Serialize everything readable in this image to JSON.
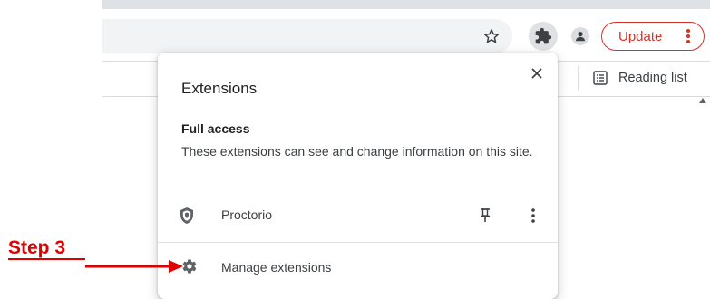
{
  "toolbar": {
    "bookmark_star": "star-icon",
    "extensions_icon": "puzzle-piece-icon",
    "profile_icon": "person-icon",
    "update_label": "Update",
    "update_color": "#d93025"
  },
  "bookmarks_bar": {
    "reading_list_label": "Reading list"
  },
  "extensions_popup": {
    "title": "Extensions",
    "section_title": "Full access",
    "section_description": "These extensions can see and change information on this site.",
    "extensions": [
      {
        "name": "Proctorio",
        "icon": "shield-icon",
        "pinned": false
      }
    ],
    "manage_label": "Manage extensions"
  },
  "annotation": {
    "label": "Step 3",
    "color": "#e00000"
  }
}
